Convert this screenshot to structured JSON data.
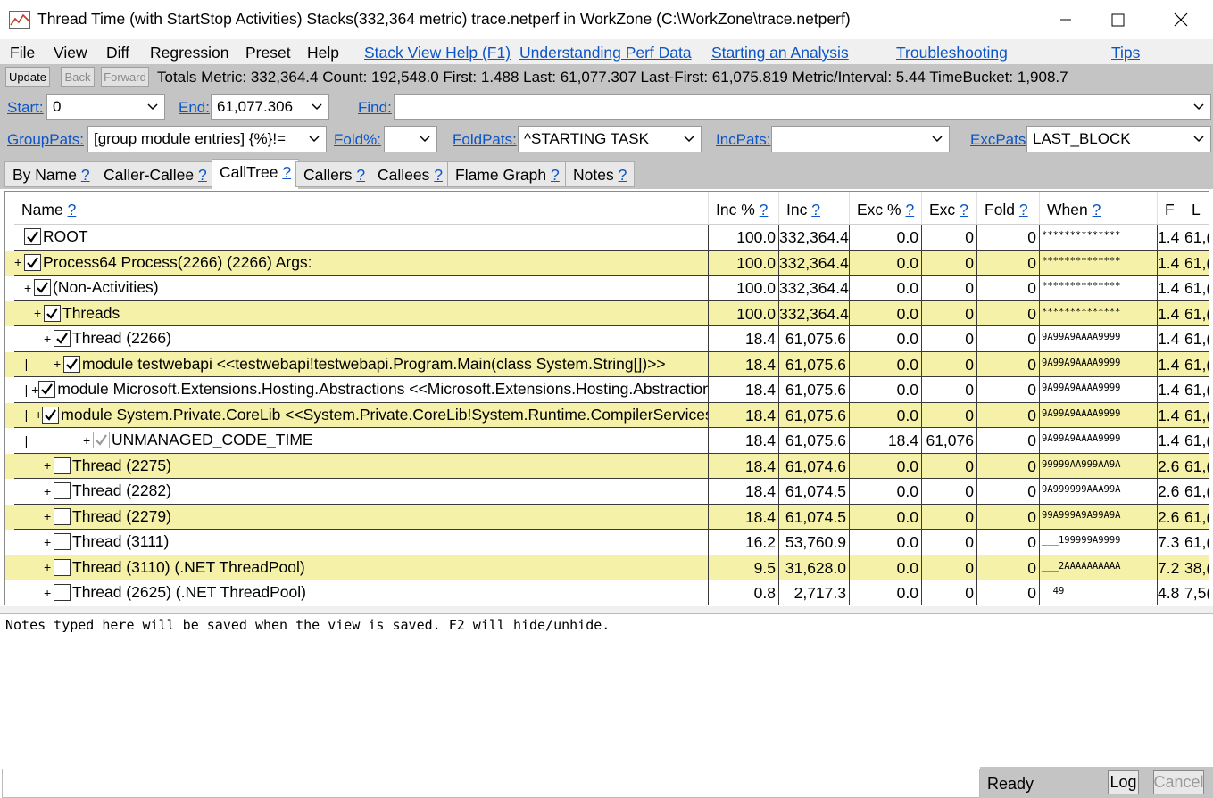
{
  "window": {
    "title": "Thread Time (with StartStop Activities) Stacks(332,364 metric) trace.netperf in WorkZone (C:\\WorkZone\\trace.netperf)",
    "min_glyph": "—",
    "max_glyph": "☐",
    "close_glyph": "✕"
  },
  "menu": {
    "items": [
      "File",
      "View",
      "Diff",
      "Regression",
      "Preset",
      "Help"
    ],
    "links": [
      "Stack View Help (F1)",
      "Understanding Perf Data",
      "Starting an Analysis",
      "Troubleshooting",
      "Tips"
    ]
  },
  "toolbar": {
    "update": "Update",
    "back": "Back",
    "forward": "Forward",
    "totals": "Totals Metric: 332,364.4  Count: 192,548.0  First: 1.488 Last: 61,077.307  Last-First: 61,075.819  Metric/Interval: 5.44  TimeBucket: 1,908.7"
  },
  "filters": {
    "start_label": "Start:",
    "start_value": "0",
    "end_label": "End:",
    "end_value": "61,077.306",
    "find_label": "Find:",
    "find_value": "",
    "grouppats_label": "GroupPats:",
    "grouppats_value": "[group module entries]  {%}!=",
    "fold_label": "Fold%:",
    "fold_value": "",
    "foldpats_label": "FoldPats:",
    "foldpats_value": "^STARTING TASK",
    "incpats_label": "IncPats:",
    "incpats_value": "",
    "excpats_label": "ExcPats:",
    "excpats_value": "LAST_BLOCK"
  },
  "tabs": [
    {
      "label": "By Name",
      "help": "?"
    },
    {
      "label": "Caller-Callee",
      "help": "?"
    },
    {
      "label": "CallTree",
      "help": "?"
    },
    {
      "label": "Callers",
      "help": "?"
    },
    {
      "label": "Callees",
      "help": "?"
    },
    {
      "label": "Flame Graph",
      "help": "?"
    },
    {
      "label": "Notes",
      "help": "?"
    }
  ],
  "columns": [
    {
      "label": "Name",
      "help": "?"
    },
    {
      "label": "Inc %",
      "help": "?"
    },
    {
      "label": "Inc",
      "help": "?"
    },
    {
      "label": "Exc %",
      "help": "?"
    },
    {
      "label": "Exc",
      "help": "?"
    },
    {
      "label": "Fold",
      "help": "?"
    },
    {
      "label": "When",
      "help": "?"
    },
    {
      "label": "F",
      "help": ""
    },
    {
      "label": "L",
      "help": ""
    }
  ],
  "rows": [
    {
      "name": "ROOT",
      "expander": "",
      "guides": "",
      "checked": "on",
      "inc_pct": "100.0",
      "inc": "332,364.4",
      "exc_pct": "0.0",
      "exc": "0",
      "fold": "0",
      "when": "**************",
      "f": "1.4",
      "l": "61,("
    },
    {
      "name": "Process64 Process(2266) (2266) Args:",
      "expander": "+",
      "guides": "",
      "checked": "on",
      "inc_pct": "100.0",
      "inc": "332,364.4",
      "exc_pct": "0.0",
      "exc": "0",
      "fold": "0",
      "when": "**************",
      "f": "1.4",
      "l": "61,("
    },
    {
      "name": "(Non-Activities)",
      "expander": "+",
      "guides": " ",
      "checked": "on",
      "inc_pct": "100.0",
      "inc": "332,364.4",
      "exc_pct": "0.0",
      "exc": "0",
      "fold": "0",
      "when": "**************",
      "f": "1.4",
      "l": "61,("
    },
    {
      "name": "Threads",
      "expander": "+",
      "guides": "  ",
      "checked": "on",
      "inc_pct": "100.0",
      "inc": "332,364.4",
      "exc_pct": "0.0",
      "exc": "0",
      "fold": "0",
      "when": "**************",
      "f": "1.4",
      "l": "61,("
    },
    {
      "name": "Thread (2266)",
      "expander": "+",
      "guides": "   ",
      "checked": "on",
      "inc_pct": "18.4",
      "inc": "61,075.6",
      "exc_pct": "0.0",
      "exc": "0",
      "fold": "0",
      "when": "9A99A9AAAA9999",
      "f": "1.4",
      "l": "61,("
    },
    {
      "name": "module testwebapi <<testwebapi!testwebapi.Program.Main(class System.String[])>>",
      "expander": "+",
      "guides": "   |",
      "checked": "on",
      "inc_pct": "18.4",
      "inc": "61,075.6",
      "exc_pct": "0.0",
      "exc": "0",
      "fold": "0",
      "when": "9A99A9AAAA9999",
      "f": "1.4",
      "l": "61,("
    },
    {
      "name": "module Microsoft.Extensions.Hosting.Abstractions <<Microsoft.Extensions.Hosting.Abstractions!",
      "expander": "+",
      "guides": "   | ",
      "checked": "on",
      "inc_pct": "18.4",
      "inc": "61,075.6",
      "exc_pct": "0.0",
      "exc": "0",
      "fold": "0",
      "when": "9A99A9AAAA9999",
      "f": "1.4",
      "l": "61,("
    },
    {
      "name": "module System.Private.CoreLib <<System.Private.CoreLib!System.Runtime.CompilerServices",
      "expander": "+",
      "guides": "   |  ",
      "checked": "on",
      "inc_pct": "18.4",
      "inc": "61,075.6",
      "exc_pct": "0.0",
      "exc": "0",
      "fold": "0",
      "when": "9A99A9AAAA9999",
      "f": "1.4",
      "l": "61,("
    },
    {
      "name": "UNMANAGED_CODE_TIME",
      "expander": "+",
      "guides": "   |   ",
      "checked": "gray",
      "inc_pct": "18.4",
      "inc": "61,075.6",
      "exc_pct": "18.4",
      "exc": "61,076",
      "fold": "0",
      "when": "9A99A9AAAA9999",
      "f": "1.4",
      "l": "61,("
    },
    {
      "name": "Thread (2275)",
      "expander": "+",
      "guides": "   ",
      "checked": "off",
      "inc_pct": "18.4",
      "inc": "61,074.6",
      "exc_pct": "0.0",
      "exc": "0",
      "fold": "0",
      "when": "99999AA999AA9A",
      "f": "2.6",
      "l": "61,("
    },
    {
      "name": "Thread (2282)",
      "expander": "+",
      "guides": "   ",
      "checked": "off",
      "inc_pct": "18.4",
      "inc": "61,074.5",
      "exc_pct": "0.0",
      "exc": "0",
      "fold": "0",
      "when": "9A999999AAA99A",
      "f": "2.6",
      "l": "61,("
    },
    {
      "name": "Thread (2279)",
      "expander": "+",
      "guides": "   ",
      "checked": "off",
      "inc_pct": "18.4",
      "inc": "61,074.5",
      "exc_pct": "0.0",
      "exc": "0",
      "fold": "0",
      "when": "99A999A9A99A9A",
      "f": "2.6",
      "l": "61,("
    },
    {
      "name": "Thread (3111)",
      "expander": "+",
      "guides": "   ",
      "checked": "off",
      "inc_pct": "16.2",
      "inc": "53,760.9",
      "exc_pct": "0.0",
      "exc": "0",
      "fold": "0",
      "when": "___199999A9999",
      "f": "7.3",
      "l": "61,("
    },
    {
      "name": "Thread (3110) (.NET ThreadPool)",
      "expander": "+",
      "guides": "   ",
      "checked": "off",
      "inc_pct": "9.5",
      "inc": "31,628.0",
      "exc_pct": "0.0",
      "exc": "0",
      "fold": "0",
      "when": "___2AAAAAAAAAA",
      "f": "7.2",
      "l": "38,("
    },
    {
      "name": "Thread (2625) (.NET ThreadPool)",
      "expander": "+",
      "guides": "   ",
      "checked": "off",
      "inc_pct": "0.8",
      "inc": "2,717.3",
      "exc_pct": "0.0",
      "exc": "0",
      "fold": "0",
      "when": "__49__________",
      "f": "4.8",
      "l": "7,5("
    }
  ],
  "notes": "Notes typed here will be saved when the view is saved. F2 will hide/unhide.",
  "status": {
    "text": "",
    "ready": "Ready",
    "log": "Log",
    "cancel": "Cancel"
  },
  "colors": {
    "link": "#0b55c6",
    "row_alt": "#f5f1a9",
    "panel": "#c4c4c4"
  }
}
